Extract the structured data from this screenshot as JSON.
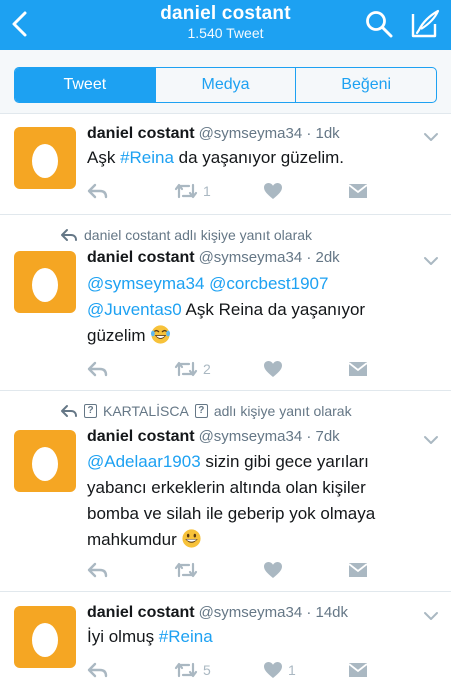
{
  "header": {
    "title": "daniel costant",
    "subtitle": "1.540 Tweet"
  },
  "tabs": [
    {
      "label": "Tweet",
      "active": true
    },
    {
      "label": "Medya",
      "active": false
    },
    {
      "label": "Beğeni",
      "active": false
    }
  ],
  "tweets": [
    {
      "name": "daniel costant",
      "handle": "@symseyma34 · 1dk",
      "text_parts": [
        "Aşk ",
        "#Reina",
        " da yaşanıyor güzelim."
      ],
      "retweets": "1",
      "likes": ""
    },
    {
      "reply_context": "daniel costant adlı kişiye yanıt olarak",
      "name": "daniel costant",
      "handle": "@symseyma34 · 2dk",
      "line1_mentions": [
        "@symseyma34",
        "@corcbest1907"
      ],
      "line2_mention": "@Juventas0",
      "line2_text": " Aşk Reina da yaşanıyor",
      "line3_text": "güzelim ",
      "emoji": "face-with-tears-of-joy",
      "retweets": "2",
      "likes": ""
    },
    {
      "reply_context_1": "KARTALİSCA",
      "reply_context_2": "adlı kişiye yanıt olarak",
      "reply_context_box": "?",
      "name": "daniel costant",
      "handle": "@symseyma34 · 7dk",
      "line1_mention": "@Adelaar1903",
      "line1_text": " sizin gibi gece yarıları",
      "line2_text": "yabancı erkeklerin altında olan kişiler",
      "line3_text": "bomba ve silah ile geberip yok olmaya",
      "line4_text": "mahkumdur ",
      "emoji": "grinning-face",
      "retweets": "",
      "likes": ""
    },
    {
      "name": "daniel costant",
      "handle": "@symseyma34 · 14dk",
      "text_parts": [
        "İyi olmuş ",
        "#Reina"
      ],
      "retweets": "5",
      "likes": "1"
    }
  ],
  "colors": {
    "brand": "#1da1f2",
    "avatar_bg": "#f5a623",
    "action_gray": "#aab8c2",
    "secondary_text": "#657786"
  }
}
